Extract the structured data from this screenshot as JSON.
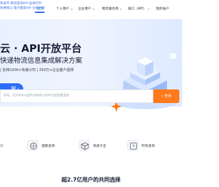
{
  "promo": {
    "line1": "快递鸟·物流查询API·运单打印",
    "line2": "免费接口·电子面单API·仓储对接"
  },
  "nav": {
    "items": [
      {
        "label": "首页"
      },
      {
        "label": "个人用户"
      },
      {
        "label": "企业用户"
      },
      {
        "label": "物流服务商"
      },
      {
        "label": "接口（API）"
      },
      {
        "label": "我的账户"
      }
    ]
  },
  "hero": {
    "title": "云 · API开放平台",
    "subtitle": "快递物流信息集成解决方案",
    "tags": "| 支持2200+快递公司 | 250万+企业客户选择",
    "cta_label": "解"
  },
  "search": {
    "placeholder": "单号，在2000+国内外快递公司中为您智能查询",
    "button_label": "查询"
  },
  "tools": [
    {
      "label": "订"
    },
    {
      "label": "国家查询",
      "icon": "globe-icon"
    },
    {
      "label": "快递大全",
      "icon": "box-icon"
    },
    {
      "label": "时效查询",
      "icon": "clock-icon"
    }
  ],
  "section": {
    "title": "超2.7亿用户的共同选择"
  },
  "colors": {
    "accent": "#2f6df6",
    "orange": "#ff7a1a",
    "title": "#1a1f36"
  }
}
